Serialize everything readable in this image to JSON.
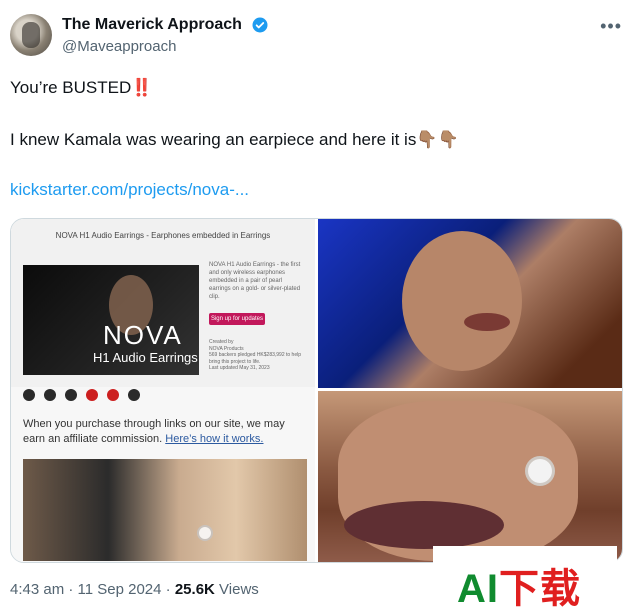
{
  "tweet": {
    "display_name": "The Maverick Approach",
    "handle": "@Maveapproach",
    "line1": "You’re BUSTED‼️",
    "line2": "I knew Kamala was wearing an earpiece and here it is👇🏽👇🏽",
    "link": "kickstarter.com/projects/nova-...",
    "timestamp": "4:43 am · 11 Sep 2024",
    "views_count": "25.6K",
    "views_label": "Views"
  },
  "media": {
    "nova_title": "NOVA H1 Audio Earrings - Earphones embedded in Earrings",
    "nova_brand": "NOVA",
    "nova_subtitle": "H1 Audio Earrings",
    "nova_description": "NOVA H1 Audio Earrings - the first and only wireless earphones embedded in a pair of pearl earrings on a gold- or silver-plated clip.",
    "nova_button": "Sign up for updates",
    "nova_created_by": "Created by",
    "nova_creator": "NOVA Products",
    "nova_backers": "569 backers pledged HK$283,992 to help bring this project to life.",
    "nova_last_updated": "Last updated May 31, 2023",
    "affiliate_text": "When you purchase through links on our site, we may earn an affiliate commission.",
    "affiliate_link": "Here’s how it works."
  },
  "watermark": {
    "text_green": "AI",
    "text_red": "下载"
  }
}
